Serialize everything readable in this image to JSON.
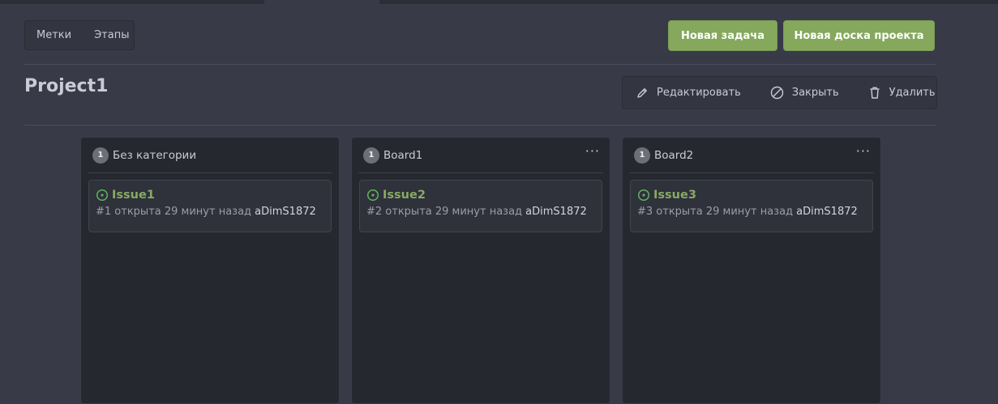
{
  "header": {
    "segment_menu": [
      {
        "label": "Метки"
      },
      {
        "label": "Этапы"
      }
    ],
    "new_issue_label": "Новая задача",
    "new_board_label": "Новая доска проекта"
  },
  "project": {
    "title": "Project1",
    "actions": {
      "edit_label": "Редактировать",
      "close_label": "Закрыть",
      "delete_label": "Удалить"
    }
  },
  "columns": [
    {
      "title": "Без категории",
      "count": "1",
      "card": {
        "title": "Issue1",
        "meta": "#1 открыта 29 минут назад",
        "author": "aDimS1872"
      }
    },
    {
      "title": "Board1",
      "count": "1",
      "menu": "···",
      "card": {
        "title": "Issue2",
        "meta": "#2 открыта 29 минут назад",
        "author": "aDimS1872"
      }
    },
    {
      "title": "Board2",
      "count": "1",
      "menu": "···",
      "card": {
        "title": "Issue3",
        "meta": "#3 открыта 29 минут назад",
        "author": "aDimS1872"
      }
    }
  ],
  "colors": {
    "background": "#383a48",
    "accent_green": "#85a85c",
    "issue_open_green": "#87ab63",
    "column_bg": "#262830"
  },
  "icons": {
    "edit": "pencil-icon",
    "close": "ban-icon",
    "delete": "trash-icon",
    "issue_state": "issue-opened-icon",
    "column_menu": "kebab-horizontal-icon"
  }
}
